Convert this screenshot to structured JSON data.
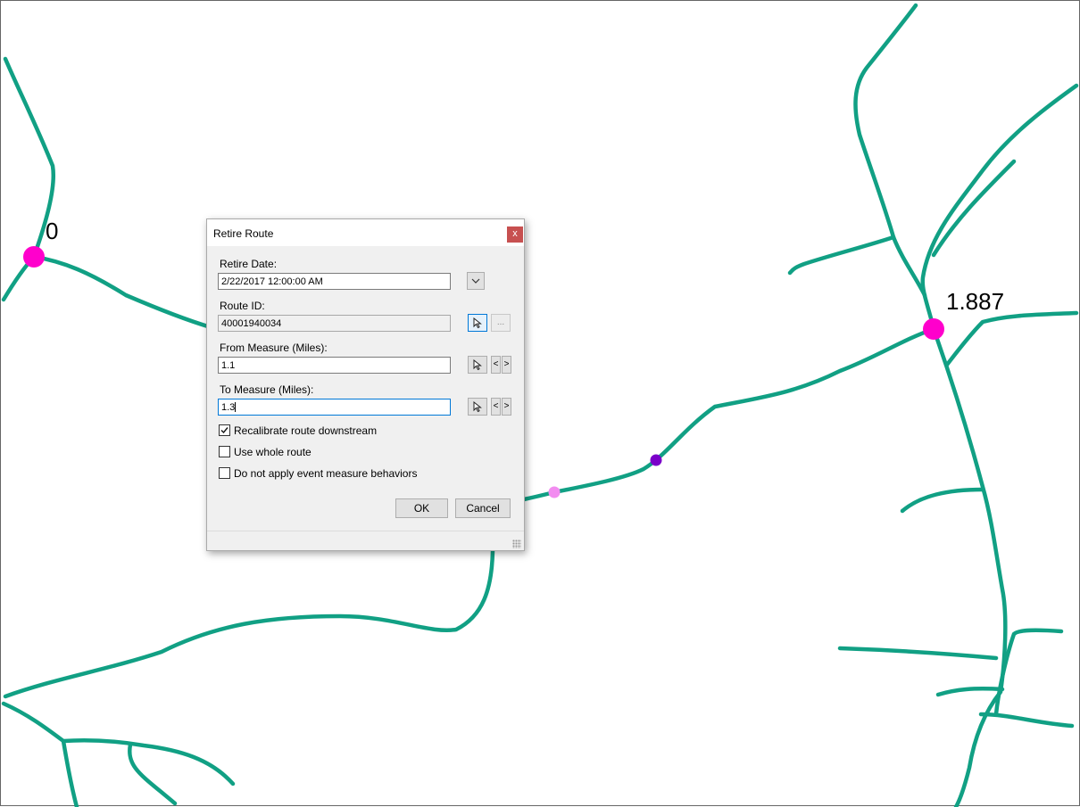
{
  "map": {
    "route_color": "#11a084",
    "endpoint_color": "#ff00cc",
    "measure_labels": [
      "0",
      "1.887"
    ],
    "point_colors": {
      "from_point": "#f28cf0",
      "to_point": "#7a00c9"
    }
  },
  "dialog": {
    "title": "Retire Route",
    "close_label": "x",
    "retire_date_label": "Retire Date:",
    "retire_date_value": "2/22/2017 12:00:00 AM",
    "route_id_label": "Route ID:",
    "route_id_value": "40001940034",
    "from_measure_label": "From Measure (Miles):",
    "from_measure_value": "1.1",
    "to_measure_label": "To Measure (Miles):",
    "to_measure_value": "1.3",
    "browse_label": "...",
    "prev_label": "<",
    "next_label": ">",
    "checkboxes": [
      {
        "label": "Recalibrate route downstream",
        "checked": true
      },
      {
        "label": "Use whole route",
        "checked": false
      },
      {
        "label": "Do not apply event measure behaviors",
        "checked": false
      }
    ],
    "ok_label": "OK",
    "cancel_label": "Cancel"
  }
}
